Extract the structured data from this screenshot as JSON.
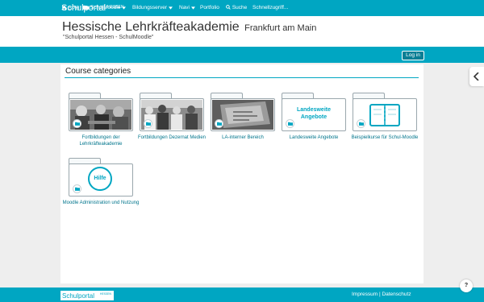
{
  "topbar": {
    "logo_text": "Schulportal",
    "logo_sup": "HESSEN"
  },
  "header": {
    "title": "Hessische Lehrkräfteakademie",
    "title_sub": "Frankfurt am Main",
    "tagline": "\"Schulportal Hessen - SchulMoodle\""
  },
  "nav": {
    "items": [
      {
        "label": "SPH",
        "icon": "home-icon"
      },
      {
        "label": "SchulMoodle",
        "icon": "folder-icon",
        "dropdown": true
      },
      {
        "label": "Bildungsserver",
        "dropdown": true
      },
      {
        "label": "Navi",
        "dropdown": true
      },
      {
        "label": "Portfolio"
      },
      {
        "label": "Suche",
        "icon": "search-icon"
      },
      {
        "label": "Schnellzugriff..."
      }
    ],
    "login_label": "Log in"
  },
  "main": {
    "heading": "Course categories",
    "categories": [
      {
        "label": "Fortbildungen der Lehrkräfteakademie",
        "image": "photo-people"
      },
      {
        "label": "Fortbildungen Dezernat Medien",
        "image": "photo-classroom"
      },
      {
        "label": "LA-interner Bereich",
        "image": "photo-desk"
      },
      {
        "label": "Landesweite Angebote",
        "image": "text-graphic",
        "graphic_text": "Landesweite Angebote"
      },
      {
        "label": "Beispielkurse für Schul-Moodle",
        "image": "notebook-graphic"
      },
      {
        "label": "Moodle Administration und Nutzung",
        "image": "help-graphic",
        "graphic_text": "Hilfe"
      }
    ]
  },
  "footer": {
    "logo_text": "Schulportal",
    "logo_sup": "HESSEN",
    "links": "Impressum | Datenschutz"
  },
  "help_button": "?",
  "colors": {
    "brand": "#00a6c2",
    "link": "#00758c",
    "login_bg": "#0a7f95"
  }
}
